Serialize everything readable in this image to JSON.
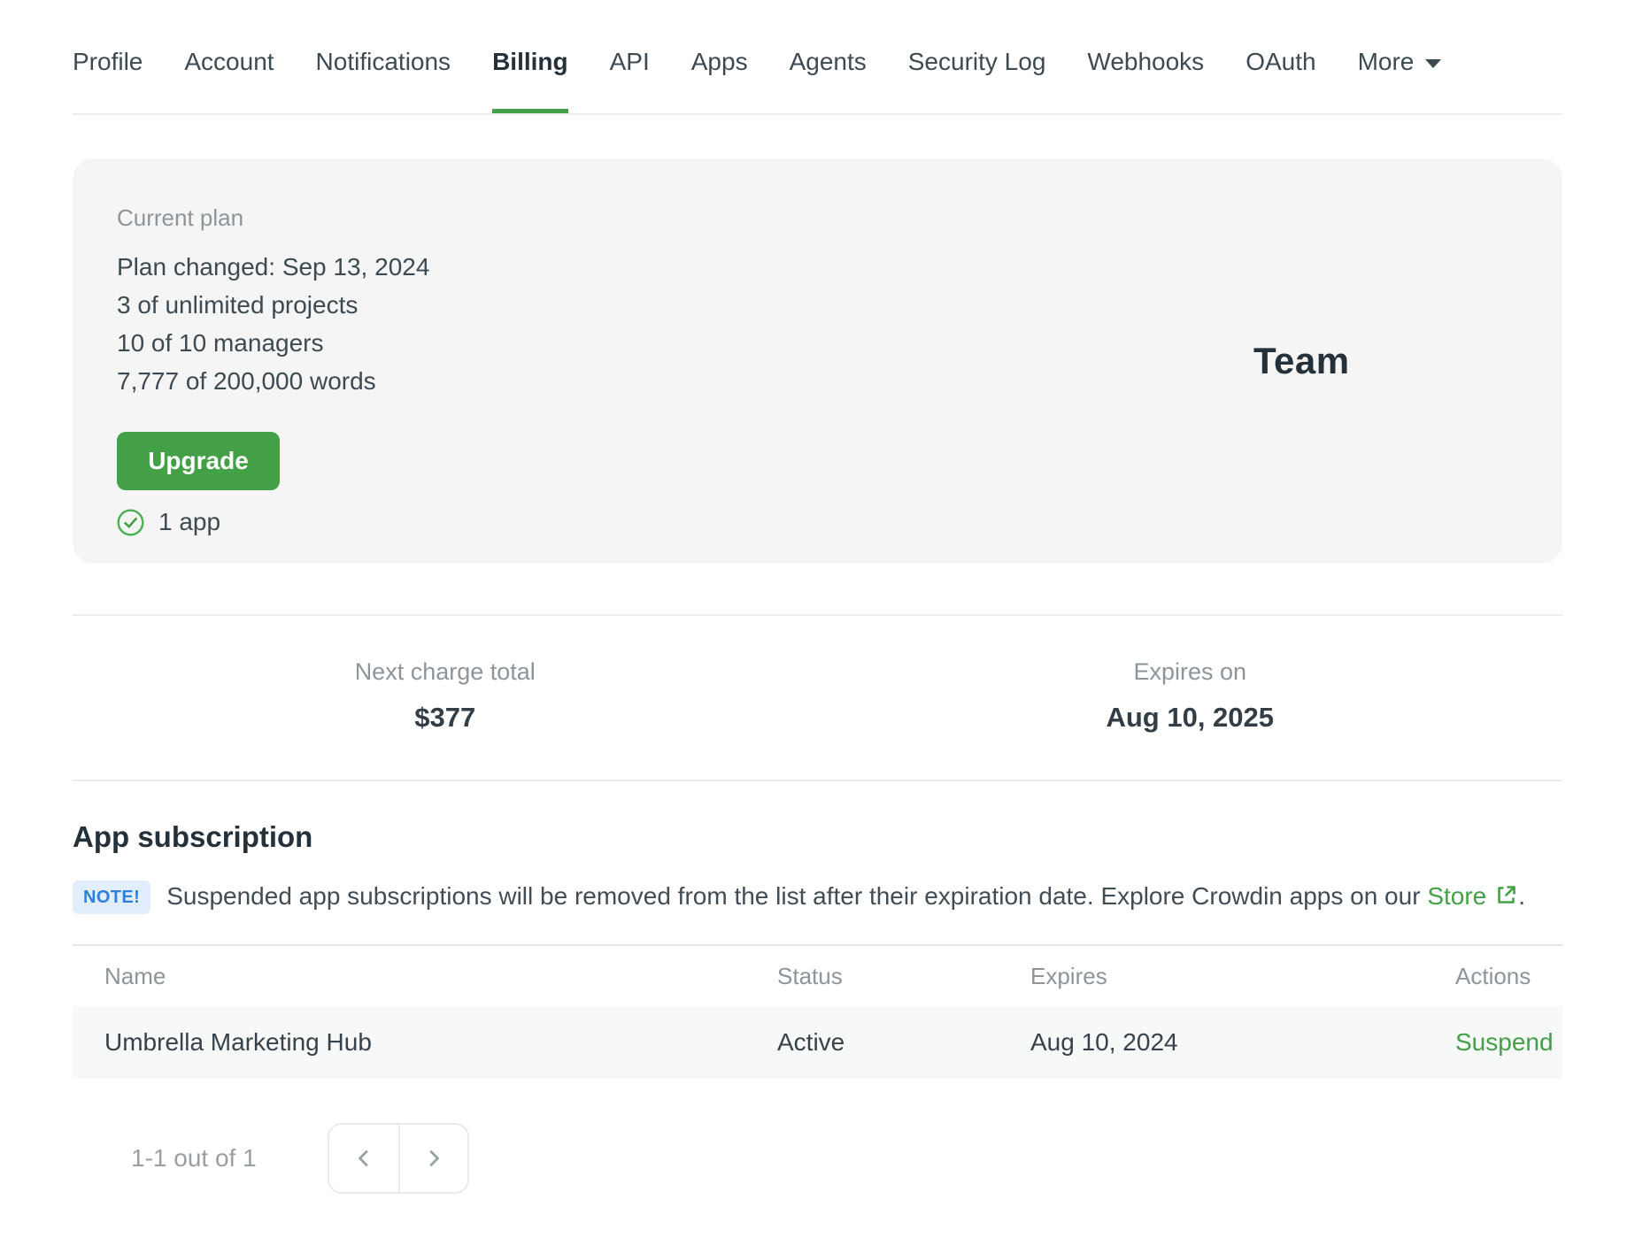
{
  "nav": {
    "tabs": [
      {
        "label": "Profile"
      },
      {
        "label": "Account"
      },
      {
        "label": "Notifications"
      },
      {
        "label": "Billing"
      },
      {
        "label": "API"
      },
      {
        "label": "Apps"
      },
      {
        "label": "Agents"
      },
      {
        "label": "Security Log"
      },
      {
        "label": "Webhooks"
      },
      {
        "label": "OAuth"
      }
    ],
    "active_tab": "Billing",
    "more_label": "More"
  },
  "plan_card": {
    "label": "Current plan",
    "lines": [
      "Plan changed: Sep 13, 2024",
      "3 of unlimited projects",
      "10 of 10 managers",
      "7,777 of 200,000 words"
    ],
    "upgrade_label": "Upgrade",
    "apps_count_label": "1 app",
    "plan_name": "Team"
  },
  "billing_summary": {
    "next_charge_label": "Next charge total",
    "next_charge_value": "$377",
    "expires_label": "Expires on",
    "expires_value": "Aug 10, 2025"
  },
  "app_subscription": {
    "title": "App subscription",
    "note_badge": "NOTE!",
    "note_text": "Suspended app subscriptions will be removed from the list after their expiration date. Explore Crowdin apps on our",
    "note_link": "Store",
    "note_suffix": ".",
    "table": {
      "headers": [
        "Name",
        "Status",
        "Expires",
        "Actions"
      ],
      "rows": [
        {
          "name": "Umbrella Marketing Hub",
          "status": "Active",
          "expires": "Aug 10, 2024",
          "action": "Suspend"
        }
      ]
    },
    "pagination_label": "1-1 out of 1"
  },
  "icons": {
    "check_circle": "check-circle-icon",
    "external_link": "external-link-icon",
    "chevron_down": "chevron-down-icon",
    "chevron_left": "chevron-left-icon",
    "chevron_right": "chevron-right-icon"
  },
  "colors": {
    "accent_green": "#43a047",
    "card_background": "#f4f5f4",
    "note_badge_bg": "#e3eefc",
    "note_badge_text": "#2f80d9",
    "row_background": "#f7f8f8",
    "muted_text": "#8d959b",
    "dark_text": "#25313a"
  }
}
